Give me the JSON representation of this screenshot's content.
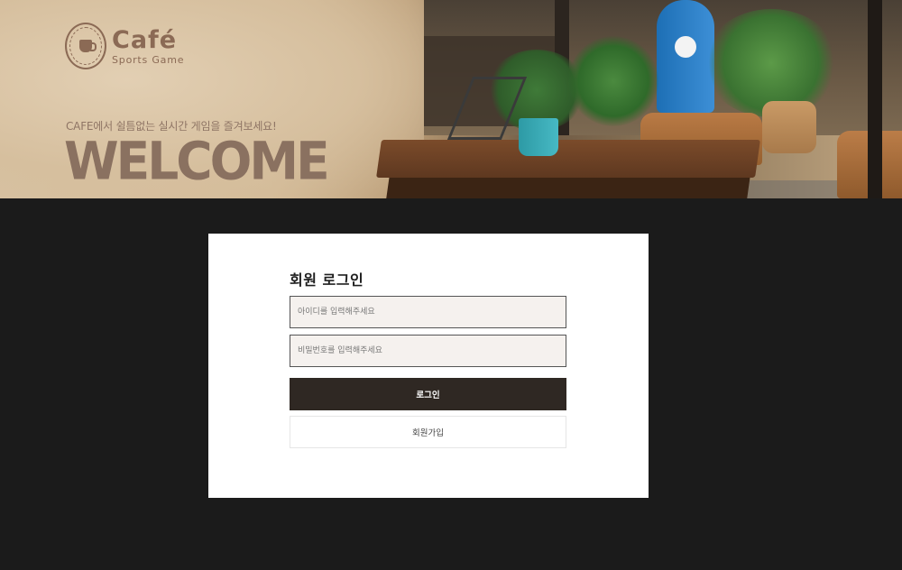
{
  "hero": {
    "brand_name": "Café",
    "brand_sub": "Sports Game",
    "tagline": "CAFE에서 쉴틈없는 실시간 게임을 즐겨보세요!",
    "welcome": "WELCOME"
  },
  "login": {
    "title": "회원 로그인",
    "id_placeholder": "아이디를 입력해주세요",
    "id_value": "",
    "pw_placeholder": "비밀번호를 입력해주세요",
    "pw_value": "",
    "login_label": "로그인",
    "join_label": "회원가입"
  },
  "colors": {
    "page_bg": "#1b1b1b",
    "brand": "#8b6a55",
    "login_button": "#2f2823",
    "field_bg": "#f5f1ee"
  },
  "icons": {
    "logo": "coffee-cup-icon"
  }
}
